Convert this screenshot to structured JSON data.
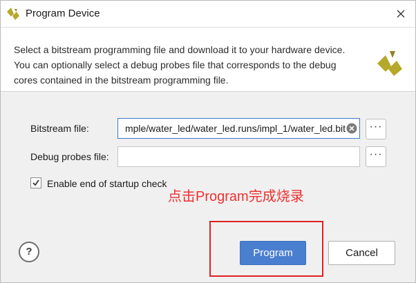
{
  "window": {
    "title": "Program Device"
  },
  "header": {
    "lines": [
      "Select a bitstream programming file and download it to your hardware device.",
      "You can optionally select a debug probes file that corresponds to the debug",
      "cores contained in the bitstream programming file."
    ]
  },
  "form": {
    "bitstream": {
      "label": "Bitstream file:",
      "value": "mple/water_led/water_led.runs/impl_1/water_led.bit",
      "browse_label": "···"
    },
    "debug_probes": {
      "label": "Debug probes file:",
      "value": "",
      "browse_label": "···"
    },
    "startup_check": {
      "label": "Enable end of startup check",
      "checked": true
    }
  },
  "annotation": {
    "text": "点击Program完成烧录",
    "color": "#ee3030"
  },
  "buttons": {
    "help": "?",
    "program": "Program",
    "cancel": "Cancel"
  },
  "colors": {
    "accent": "#4a7fd0",
    "logo": "#b5a82a",
    "highlight_box": "#e02020"
  },
  "icons": [
    "vivado-logo-icon",
    "close-icon",
    "clear-icon",
    "checkmark-icon",
    "help-icon"
  ]
}
